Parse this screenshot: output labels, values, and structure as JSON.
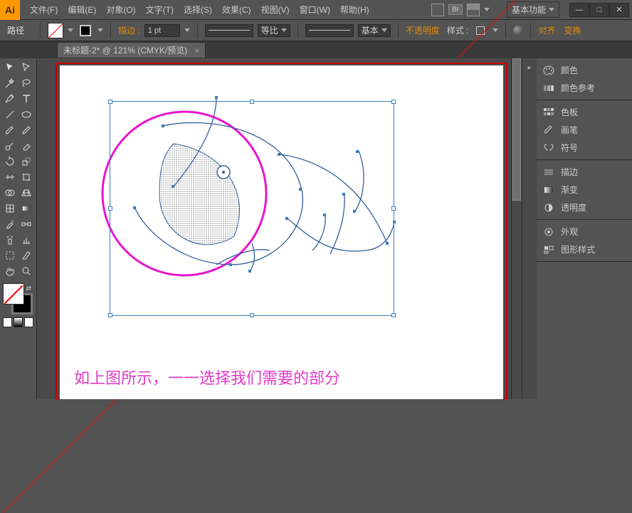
{
  "app": {
    "logo": "Ai"
  },
  "menu": {
    "items": [
      "文件(F)",
      "编辑(E)",
      "对象(O)",
      "文字(T)",
      "选择(S)",
      "效果(C)",
      "视图(V)",
      "窗口(W)",
      "帮助(H)"
    ]
  },
  "title": {
    "br": "Br",
    "workspace": "基本功能"
  },
  "winctrl": {
    "min": "—",
    "max": "□",
    "close": "✕"
  },
  "ctrl": {
    "path": "路径",
    "stroke_label": "描边 :",
    "stroke_pt": "1 pt",
    "ratio": "等比",
    "basic": "基本",
    "opacity": "不透明度",
    "style": "样式 :",
    "align": "对齐",
    "transform": "变换"
  },
  "tab": {
    "title": "未标题-2* @ 121% (CMYK/预览)",
    "close": "×"
  },
  "canvas": {
    "caption": "如上图所示，一一选择我们需要的部分"
  },
  "panels": {
    "g1": [
      {
        "icon": "palette",
        "label": "颜色"
      },
      {
        "icon": "guide",
        "label": "颜色参考"
      }
    ],
    "g2": [
      {
        "icon": "swatch",
        "label": "色板"
      },
      {
        "icon": "brush",
        "label": "画笔"
      },
      {
        "icon": "symbol",
        "label": "符号"
      }
    ],
    "g3": [
      {
        "icon": "stroke",
        "label": "描边"
      },
      {
        "icon": "grad",
        "label": "渐变"
      },
      {
        "icon": "trans",
        "label": "透明度"
      }
    ],
    "g4": [
      {
        "icon": "appear",
        "label": "外观"
      },
      {
        "icon": "gstyle",
        "label": "图形样式"
      }
    ]
  }
}
